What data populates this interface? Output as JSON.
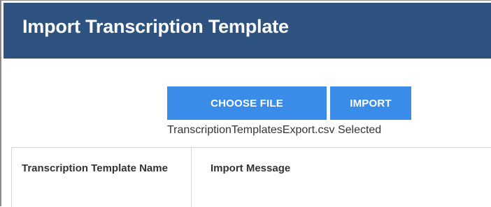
{
  "dialog": {
    "title": "Import Transcription Template",
    "header_color": "#2e5380"
  },
  "actions": {
    "choose_file_label": "CHOOSE FILE",
    "import_label": "IMPORT",
    "button_color": "#3b8ce8",
    "selected_file_text": "TranscriptionTemplatesExport.csv Selected"
  },
  "table": {
    "columns": [
      {
        "label": "Transcription Template Name"
      },
      {
        "label": "Import Message"
      }
    ]
  }
}
